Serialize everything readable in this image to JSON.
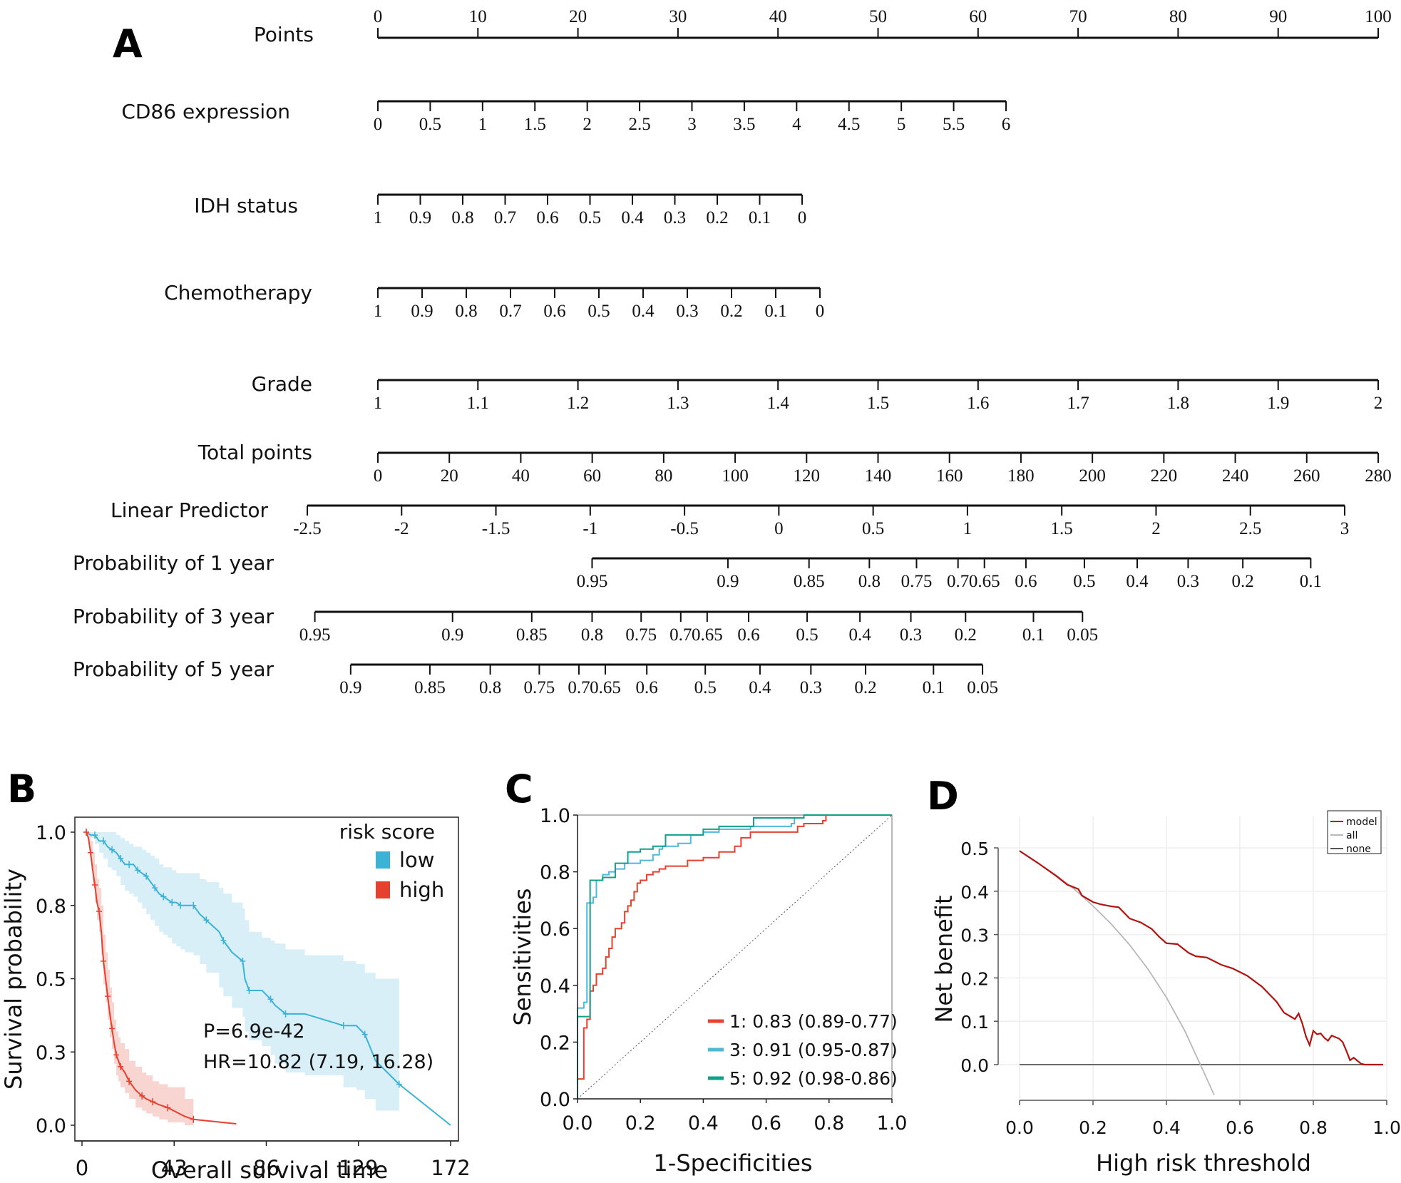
{
  "chart_data": [
    {
      "panel": "A",
      "type": "nomogram",
      "rows": [
        {
          "label": "Points",
          "ticks": [
            "0",
            "10",
            "20",
            "30",
            "40",
            "50",
            "60",
            "70",
            "80",
            "90",
            "100"
          ],
          "values": [
            0,
            10,
            20,
            30,
            40,
            50,
            60,
            70,
            80,
            90,
            100
          ],
          "range": [
            0,
            100
          ],
          "labels_above": true
        },
        {
          "label": "CD86 expression",
          "ticks": [
            "0",
            "0.5",
            "1",
            "1.5",
            "2",
            "2.5",
            "3",
            "3.5",
            "4",
            "4.5",
            "5",
            "5.5",
            "6"
          ],
          "values": [
            0,
            0.5,
            1,
            1.5,
            2,
            2.5,
            3,
            3.5,
            4,
            4.5,
            5,
            5.5,
            6
          ],
          "points_range": [
            0,
            62.7
          ]
        },
        {
          "label": "IDH status",
          "ticks": [
            "1",
            "0.9",
            "0.8",
            "0.7",
            "0.6",
            "0.5",
            "0.4",
            "0.3",
            "0.2",
            "0.1",
            "0"
          ],
          "values": [
            1,
            0.9,
            0.8,
            0.7,
            0.6,
            0.5,
            0.4,
            0.3,
            0.2,
            0.1,
            0
          ],
          "points_range": [
            0,
            42.4
          ]
        },
        {
          "label": "Chemotherapy",
          "ticks": [
            "1",
            "0.9",
            "0.8",
            "0.7",
            "0.6",
            "0.5",
            "0.4",
            "0.3",
            "0.2",
            "0.1",
            "0"
          ],
          "values": [
            1,
            0.9,
            0.8,
            0.7,
            0.6,
            0.5,
            0.4,
            0.3,
            0.2,
            0.1,
            0
          ],
          "points_range": [
            0,
            44.2
          ]
        },
        {
          "label": "Grade",
          "ticks": [
            "1",
            "1.1",
            "1.2",
            "1.3",
            "1.4",
            "1.5",
            "1.6",
            "1.7",
            "1.8",
            "1.9",
            "2"
          ],
          "values": [
            1,
            1.1,
            1.2,
            1.3,
            1.4,
            1.5,
            1.6,
            1.7,
            1.8,
            1.9,
            2
          ],
          "points_range": [
            0,
            100
          ]
        },
        {
          "label": "Total points",
          "ticks": [
            "0",
            "20",
            "40",
            "60",
            "80",
            "100",
            "120",
            "140",
            "160",
            "180",
            "200",
            "220",
            "240",
            "260",
            "280"
          ],
          "values": [
            0,
            20,
            40,
            60,
            80,
            100,
            120,
            140,
            160,
            180,
            200,
            220,
            240,
            260,
            280
          ],
          "total_range": [
            0,
            280
          ]
        },
        {
          "label": "Linear Predictor",
          "ticks": [
            "-2.5",
            "-2",
            "-1.5",
            "-1",
            "-0.5",
            "0",
            "0.5",
            "1",
            "1.5",
            "2",
            "2.5",
            "3"
          ],
          "values": [
            -2.5,
            -2,
            -1.5,
            -1,
            -0.5,
            0,
            0.5,
            1,
            1.5,
            2,
            2.5,
            3
          ]
        },
        {
          "label": "Probability of 1 year",
          "ticks": [
            "0.95",
            "0.9",
            "0.85",
            "0.8",
            "0.75",
            "0.7",
            "0.65",
            "0.6",
            "0.5",
            "0.4",
            "0.3",
            "0.2",
            "0.1"
          ],
          "lp_values": [
            -0.99,
            -0.27,
            0.16,
            0.48,
            0.73,
            0.95,
            1.09,
            1.31,
            1.62,
            1.9,
            2.17,
            2.46,
            2.82
          ]
        },
        {
          "label": "Probability of 3 year",
          "ticks": [
            "0.95",
            "0.9",
            "0.85",
            "0.8",
            "0.75",
            "0.7",
            "0.65",
            "0.6",
            "0.5",
            "0.4",
            "0.3",
            "0.2",
            "0.1",
            "0.05"
          ],
          "lp_values": [
            -2.46,
            -1.73,
            -1.31,
            -0.99,
            -0.73,
            -0.52,
            -0.38,
            -0.16,
            0.15,
            0.43,
            0.7,
            0.99,
            1.35,
            1.61
          ]
        },
        {
          "label": "Probability of 5 year",
          "ticks": [
            "0.9",
            "0.85",
            "0.8",
            "0.75",
            "0.7",
            "0.65",
            "0.6",
            "0.5",
            "0.4",
            "0.3",
            "0.2",
            "0.1",
            "0.05"
          ],
          "lp_values": [
            -2.27,
            -1.85,
            -1.53,
            -1.27,
            -1.06,
            -0.92,
            -0.7,
            -0.39,
            -0.1,
            0.17,
            0.46,
            0.82,
            1.08
          ]
        }
      ]
    },
    {
      "panel": "B",
      "type": "line",
      "subtype": "kaplan-meier",
      "xlabel": "Overall survival time",
      "ylabel": "Survival probability",
      "xticks": [
        "0",
        "43",
        "86",
        "129",
        "172"
      ],
      "xtick_values": [
        0,
        43,
        86,
        129,
        172
      ],
      "yticks": [
        "0.0",
        "0.3",
        "0.5",
        "0.8",
        "1.0"
      ],
      "ytick_values": [
        0,
        0.25,
        0.5,
        0.75,
        1.0
      ],
      "xlim": [
        0,
        172
      ],
      "ylim": [
        -0.06,
        1.06
      ],
      "legend_title": "risk score",
      "legend_position": "top-right",
      "annotations": [
        "P=6.9e-42",
        "HR=10.82 (7.19, 16.28)"
      ],
      "series": [
        {
          "name": "low",
          "color": "#3bb3d6",
          "band_color": "#d6eef7",
          "x": [
            2,
            4,
            6,
            8,
            10,
            12,
            14,
            16,
            18,
            20,
            22,
            24,
            26,
            28,
            30,
            32,
            34,
            36,
            38,
            40,
            42,
            44,
            46,
            48,
            52,
            55,
            58,
            64,
            66,
            70,
            75,
            76,
            78,
            84,
            88,
            90,
            95,
            104,
            122,
            128,
            132,
            137,
            148,
            172
          ],
          "y": [
            1.0,
            0.99,
            0.99,
            0.97,
            0.97,
            0.95,
            0.94,
            0.93,
            0.91,
            0.89,
            0.89,
            0.89,
            0.87,
            0.86,
            0.85,
            0.83,
            0.81,
            0.79,
            0.78,
            0.77,
            0.76,
            0.76,
            0.75,
            0.75,
            0.75,
            0.72,
            0.7,
            0.66,
            0.63,
            0.59,
            0.56,
            0.5,
            0.46,
            0.46,
            0.43,
            0.41,
            0.38,
            0.38,
            0.34,
            0.34,
            0.31,
            0.22,
            0.14,
            0.0
          ],
          "lower": [
            1.0,
            0.98,
            0.96,
            0.93,
            0.91,
            0.88,
            0.87,
            0.85,
            0.82,
            0.8,
            0.79,
            0.78,
            0.76,
            0.74,
            0.72,
            0.7,
            0.68,
            0.66,
            0.65,
            0.64,
            0.62,
            0.61,
            0.6,
            0.59,
            0.58,
            0.55,
            0.52,
            0.47,
            0.44,
            0.4,
            0.37,
            0.32,
            0.29,
            0.27,
            0.24,
            0.21,
            0.18,
            0.17,
            0.13,
            0.12,
            0.09,
            0.05,
            0.03
          ],
          "upper": [
            1.0,
            1.0,
            1.0,
            1.0,
            1.0,
            1.0,
            1.0,
            0.99,
            0.98,
            0.97,
            0.96,
            0.95,
            0.95,
            0.94,
            0.93,
            0.92,
            0.91,
            0.89,
            0.88,
            0.88,
            0.87,
            0.86,
            0.86,
            0.86,
            0.86,
            0.84,
            0.83,
            0.81,
            0.79,
            0.76,
            0.74,
            0.7,
            0.66,
            0.64,
            0.63,
            0.62,
            0.6,
            0.58,
            0.56,
            0.55,
            0.52,
            0.5,
            0.5
          ]
        },
        {
          "name": "high",
          "color": "#e8402f",
          "band_color": "#f8d3cf",
          "x": [
            2,
            3,
            4,
            5,
            6,
            7,
            8,
            9,
            10,
            11,
            12,
            13,
            14,
            15,
            16,
            17,
            18,
            20,
            22,
            25,
            28,
            30,
            33,
            36,
            40,
            48,
            52,
            72
          ],
          "y": [
            1.0,
            0.98,
            0.93,
            0.87,
            0.82,
            0.76,
            0.73,
            0.66,
            0.56,
            0.5,
            0.44,
            0.38,
            0.33,
            0.28,
            0.24,
            0.22,
            0.2,
            0.18,
            0.15,
            0.12,
            0.1,
            0.09,
            0.08,
            0.07,
            0.06,
            0.03,
            0.02,
            0.005
          ],
          "lower": [
            1.0,
            0.96,
            0.9,
            0.82,
            0.76,
            0.7,
            0.66,
            0.58,
            0.48,
            0.42,
            0.36,
            0.3,
            0.26,
            0.21,
            0.17,
            0.15,
            0.13,
            0.11,
            0.09,
            0.06,
            0.05,
            0.04,
            0.03,
            0.02,
            0.01,
            0.0,
            0.0
          ],
          "upper": [
            1.0,
            1.0,
            0.97,
            0.93,
            0.89,
            0.84,
            0.81,
            0.75,
            0.65,
            0.59,
            0.53,
            0.47,
            0.42,
            0.36,
            0.32,
            0.3,
            0.28,
            0.26,
            0.22,
            0.2,
            0.18,
            0.17,
            0.15,
            0.14,
            0.13,
            0.09,
            0.08
          ]
        }
      ]
    },
    {
      "panel": "C",
      "type": "line",
      "subtype": "roc",
      "xlabel": "1-Specificities",
      "ylabel": "Sensitivities",
      "xticks": [
        "0.0",
        "0.2",
        "0.4",
        "0.6",
        "0.8",
        "1.0"
      ],
      "yticks": [
        "0.0",
        "0.2",
        "0.4",
        "0.6",
        "0.8",
        "1.0"
      ],
      "xlim": [
        0,
        1
      ],
      "ylim": [
        0,
        1
      ],
      "legend_position": "bottom-right",
      "diagonal": true,
      "series": [
        {
          "name": "1: 0.83 (0.89-0.77)",
          "color": "#e8402f",
          "x": [
            0,
            0.0,
            0.02,
            0.02,
            0.03,
            0.04,
            0.05,
            0.06,
            0.08,
            0.09,
            0.1,
            0.11,
            0.12,
            0.13,
            0.14,
            0.15,
            0.16,
            0.17,
            0.18,
            0.19,
            0.2,
            0.22,
            0.24,
            0.26,
            0.28,
            0.35,
            0.4,
            0.45,
            0.5,
            0.52,
            0.55,
            0.68,
            0.7,
            0.72,
            0.78,
            0.79,
            1.0
          ],
          "y": [
            0,
            0.07,
            0.12,
            0.25,
            0.28,
            0.38,
            0.4,
            0.44,
            0.46,
            0.5,
            0.53,
            0.57,
            0.6,
            0.6,
            0.62,
            0.66,
            0.68,
            0.7,
            0.73,
            0.76,
            0.77,
            0.79,
            0.8,
            0.81,
            0.82,
            0.84,
            0.85,
            0.87,
            0.89,
            0.92,
            0.94,
            0.94,
            0.96,
            0.97,
            0.98,
            1.0,
            1.0
          ]
        },
        {
          "name": "3: 0.91 (0.95-0.87)",
          "color": "#4fb8db",
          "x": [
            0,
            0.0,
            0.02,
            0.03,
            0.03,
            0.05,
            0.06,
            0.08,
            0.1,
            0.12,
            0.15,
            0.2,
            0.24,
            0.26,
            0.27,
            0.32,
            0.36,
            0.4,
            0.45,
            0.55,
            0.68,
            0.69,
            0.72,
            1.0
          ],
          "y": [
            0,
            0.32,
            0.34,
            0.36,
            0.69,
            0.71,
            0.77,
            0.79,
            0.8,
            0.81,
            0.83,
            0.84,
            0.86,
            0.88,
            0.89,
            0.9,
            0.93,
            0.94,
            0.95,
            0.96,
            0.97,
            0.99,
            1.0,
            1.0
          ]
        },
        {
          "name": "5: 0.92 (0.98-0.86)",
          "color": "#11a08a",
          "x": [
            0,
            0.0,
            0.04,
            0.04,
            0.08,
            0.12,
            0.12,
            0.16,
            0.16,
            0.2,
            0.24,
            0.28,
            0.28,
            0.35,
            0.4,
            0.45,
            0.56,
            0.56,
            0.7,
            0.72,
            1.0
          ],
          "y": [
            0,
            0.29,
            0.29,
            0.77,
            0.78,
            0.79,
            0.83,
            0.84,
            0.87,
            0.88,
            0.89,
            0.89,
            0.93,
            0.93,
            0.95,
            0.96,
            0.97,
            0.99,
            0.99,
            1.0,
            1.0
          ]
        }
      ]
    },
    {
      "panel": "D",
      "type": "line",
      "subtype": "decision-curve",
      "xlabel": "High risk threshold",
      "ylabel": "Net benefit",
      "xticks": [
        "0.0",
        "0.2",
        "0.4",
        "0.6",
        "0.8",
        "1.0"
      ],
      "yticks": [
        "0.0",
        "0.1",
        "0.2",
        "0.3",
        "0.4",
        "0.5"
      ],
      "xlim": [
        0,
        1
      ],
      "ylim": [
        -0.07,
        0.5
      ],
      "grid": true,
      "legend_position": "top-right",
      "series": [
        {
          "name": "model",
          "color": "#b3120f",
          "x": [
            0,
            0.05,
            0.1,
            0.13,
            0.16,
            0.17,
            0.18,
            0.2,
            0.22,
            0.25,
            0.27,
            0.3,
            0.33,
            0.36,
            0.38,
            0.4,
            0.43,
            0.46,
            0.48,
            0.51,
            0.55,
            0.58,
            0.62,
            0.66,
            0.7,
            0.72,
            0.74,
            0.75,
            0.76,
            0.77,
            0.78,
            0.79,
            0.8,
            0.81,
            0.82,
            0.83,
            0.84,
            0.85,
            0.87,
            0.88,
            0.89,
            0.9,
            0.91,
            0.93,
            0.94,
            0.99
          ],
          "y": [
            0.493,
            0.465,
            0.435,
            0.415,
            0.405,
            0.39,
            0.385,
            0.375,
            0.37,
            0.365,
            0.363,
            0.337,
            0.328,
            0.313,
            0.295,
            0.28,
            0.278,
            0.258,
            0.25,
            0.247,
            0.23,
            0.222,
            0.205,
            0.18,
            0.145,
            0.12,
            0.11,
            0.105,
            0.118,
            0.095,
            0.065,
            0.045,
            0.078,
            0.07,
            0.072,
            0.062,
            0.055,
            0.067,
            0.06,
            0.052,
            0.032,
            0.01,
            0.016,
            0.002,
            0.0,
            0.0
          ]
        },
        {
          "name": "all",
          "color": "#b8b8b8",
          "x": [
            0,
            0.1,
            0.15,
            0.2,
            0.25,
            0.3,
            0.35,
            0.4,
            0.45,
            0.5,
            0.53
          ],
          "y": [
            0.493,
            0.437,
            0.404,
            0.366,
            0.324,
            0.276,
            0.22,
            0.155,
            0.078,
            -0.014,
            -0.07
          ]
        },
        {
          "name": "none",
          "color": "#555555",
          "x": [
            0,
            0.99
          ],
          "y": [
            0,
            0
          ]
        }
      ]
    }
  ],
  "panel_labels": [
    "A",
    "B",
    "C",
    "D"
  ]
}
